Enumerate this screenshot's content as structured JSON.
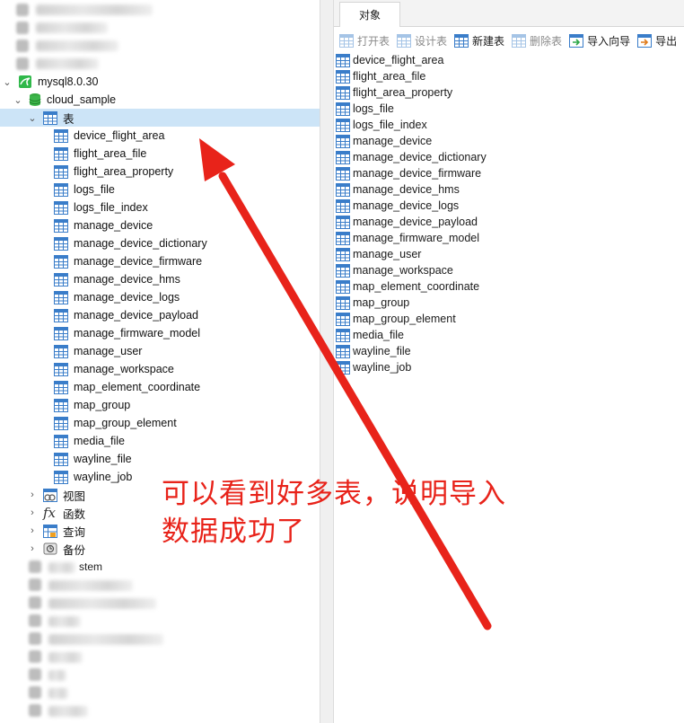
{
  "connection": {
    "name": "mysql8.0.30"
  },
  "database": {
    "name": "cloud_sample"
  },
  "tables_node": {
    "label": "表"
  },
  "tables": [
    "device_flight_area",
    "flight_area_file",
    "flight_area_property",
    "logs_file",
    "logs_file_index",
    "manage_device",
    "manage_device_dictionary",
    "manage_device_firmware",
    "manage_device_hms",
    "manage_device_logs",
    "manage_device_payload",
    "manage_firmware_model",
    "manage_user",
    "manage_workspace",
    "map_element_coordinate",
    "map_group",
    "map_group_element",
    "media_file",
    "wayline_file",
    "wayline_job"
  ],
  "other_nodes": [
    {
      "label": "视图",
      "icon": "view-icon"
    },
    {
      "label": "函数",
      "icon": "function-icon"
    },
    {
      "label": "查询",
      "icon": "query-icon"
    },
    {
      "label": "备份",
      "icon": "backup-icon"
    }
  ],
  "partial_system_label": "stem",
  "tab": {
    "label": "对象"
  },
  "toolbar": {
    "open_table": "打开表",
    "design_table": "设计表",
    "new_table": "新建表",
    "delete_table": "删除表",
    "import_wizard": "导入向导",
    "export": "导出"
  },
  "annotation": {
    "line1": "可以看到好多表，说明导入",
    "line2": "数据成功了",
    "color": "#e8231a"
  },
  "colors": {
    "selection": "#cce4f7",
    "table_icon": "#3a7dc9"
  }
}
